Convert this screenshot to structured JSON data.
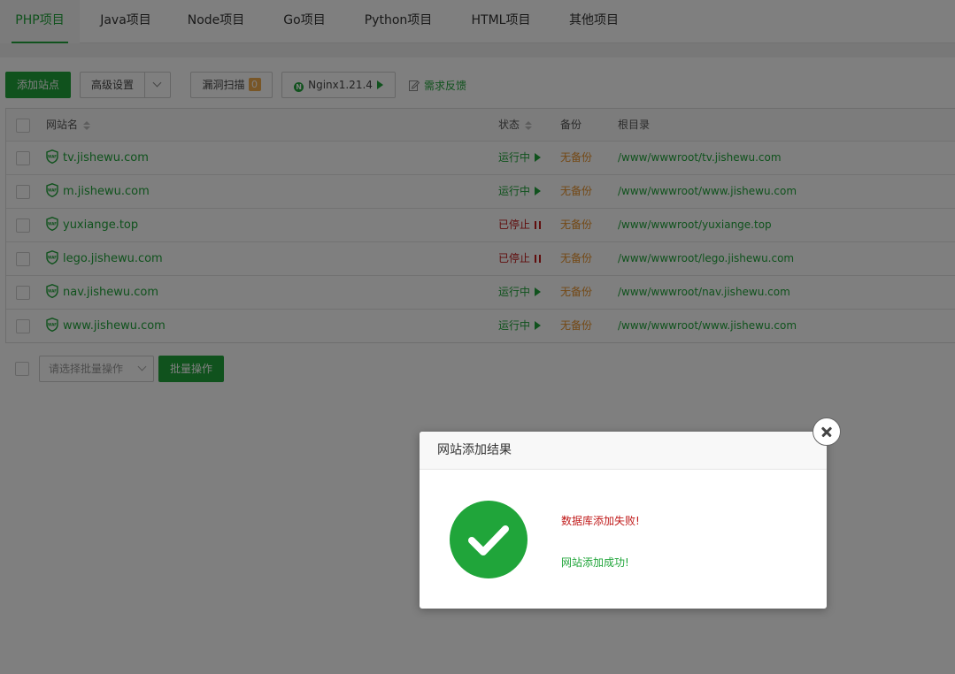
{
  "tabs": [
    {
      "label": "PHP项目",
      "active": true
    },
    {
      "label": "Java项目"
    },
    {
      "label": "Node项目"
    },
    {
      "label": "Go项目"
    },
    {
      "label": "Python项目"
    },
    {
      "label": "HTML项目"
    },
    {
      "label": "其他项目"
    }
  ],
  "toolbar": {
    "add_site": "添加站点",
    "advanced": "高级设置",
    "vuln_scan": "漏洞扫描",
    "vuln_count": "0",
    "nginx": "Nginx1.21.4",
    "feedback": "需求反馈"
  },
  "table": {
    "headers": {
      "name": "网站名",
      "status": "状态",
      "backup": "备份",
      "root": "根目录"
    },
    "rows": [
      {
        "name": "tv.jishewu.com",
        "status": "运行中",
        "running": true,
        "backup": "无备份",
        "root": "/www/wwwroot/tv.jishewu.com"
      },
      {
        "name": "m.jishewu.com",
        "status": "运行中",
        "running": true,
        "backup": "无备份",
        "root": "/www/wwwroot/www.jishewu.com"
      },
      {
        "name": "yuxiange.top",
        "status": "已停止",
        "running": false,
        "backup": "无备份",
        "root": "/www/wwwroot/yuxiange.top"
      },
      {
        "name": "lego.jishewu.com",
        "status": "已停止",
        "running": false,
        "backup": "无备份",
        "root": "/www/wwwroot/lego.jishewu.com"
      },
      {
        "name": "nav.jishewu.com",
        "status": "运行中",
        "running": true,
        "backup": "无备份",
        "root": "/www/wwwroot/nav.jishewu.com"
      },
      {
        "name": "www.jishewu.com",
        "status": "运行中",
        "running": true,
        "backup": "无备份",
        "root": "/www/wwwroot/www.jishewu.com"
      }
    ]
  },
  "batch": {
    "select_placeholder": "请选择批量操作",
    "button": "批量操作"
  },
  "modal": {
    "title": "网站添加结果",
    "db_message": "数据库添加失败!",
    "site_message": "网站添加成功!"
  },
  "colors": {
    "accent": "#20a53a",
    "error": "#c01a1a",
    "warning": "#e8922c"
  },
  "icons": {
    "waf": "waf-shield-icon",
    "close": "close-icon",
    "success": "check-circle-icon"
  }
}
